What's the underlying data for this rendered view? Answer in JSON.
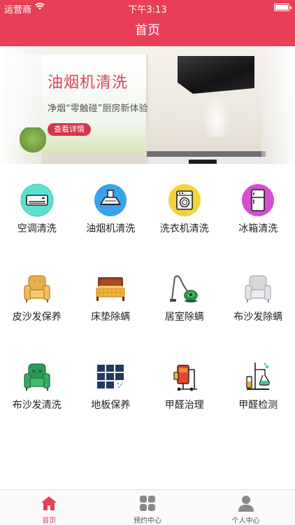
{
  "status": {
    "carrier": "运营商",
    "time": "下午3:13"
  },
  "nav": {
    "title": "首页"
  },
  "banner": {
    "title": "油烟机清洗",
    "subtitle": "净烟“零触碰”厨房新体验",
    "button": "查看详情",
    "slides": 4,
    "active_slide": 1
  },
  "services": [
    {
      "label": "空调清洗",
      "icon": "air-conditioner-icon"
    },
    {
      "label": "油烟机清洗",
      "icon": "range-hood-icon"
    },
    {
      "label": "洗衣机清洗",
      "icon": "washing-machine-icon"
    },
    {
      "label": "冰箱清洗",
      "icon": "fridge-icon"
    },
    {
      "label": "皮沙发保养",
      "icon": "leather-sofa-icon"
    },
    {
      "label": "床垫除螨",
      "icon": "bed-icon"
    },
    {
      "label": "居室除螨",
      "icon": "vacuum-icon"
    },
    {
      "label": "布沙发除螨",
      "icon": "fabric-sofa-icon"
    },
    {
      "label": "布沙发清洗",
      "icon": "green-sofa-icon"
    },
    {
      "label": "地板保养",
      "icon": "floor-tiles-icon"
    },
    {
      "label": "甲醛治理",
      "icon": "formaldehyde-machine-icon"
    },
    {
      "label": "甲醛检测",
      "icon": "lab-flask-icon"
    }
  ],
  "tabs": [
    {
      "label": "首页",
      "icon": "home-icon",
      "active": true
    },
    {
      "label": "预约中心",
      "icon": "grid-icon",
      "active": false
    },
    {
      "label": "个人中心",
      "icon": "user-icon",
      "active": false
    }
  ],
  "colors": {
    "brand": "#e83e58",
    "tab_inactive": "#555555"
  }
}
